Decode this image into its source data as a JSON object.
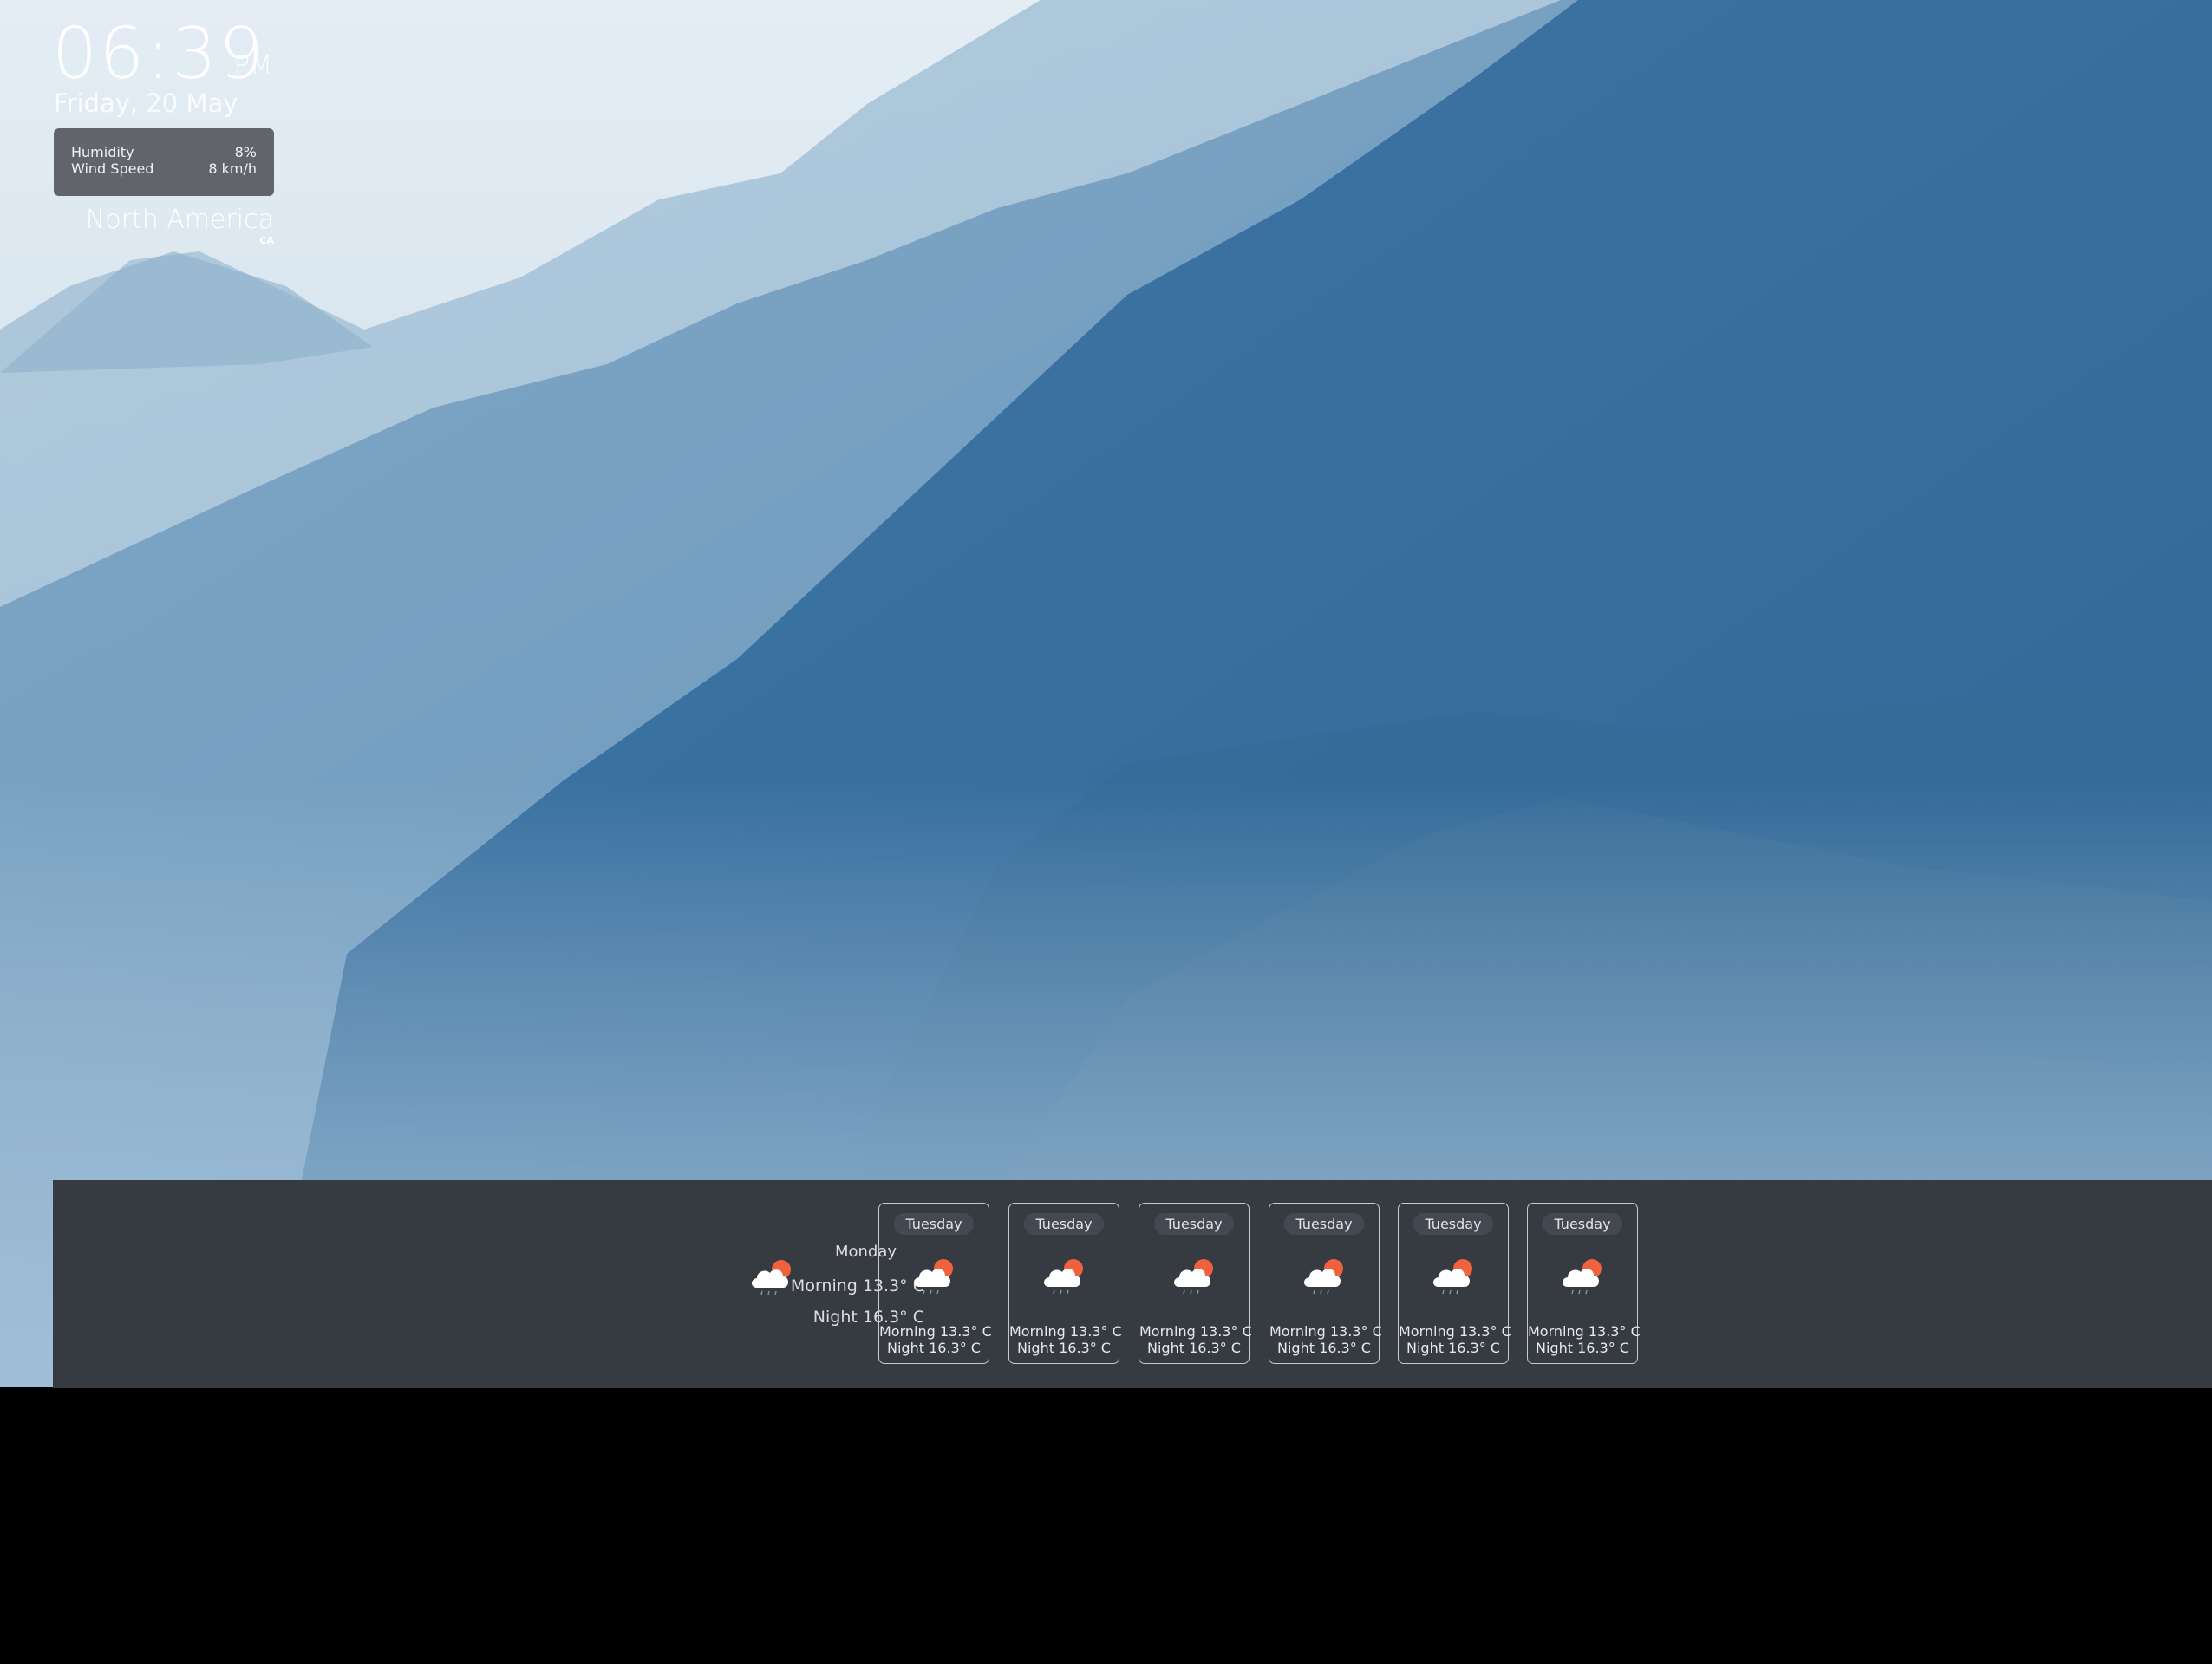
{
  "clock": {
    "time": "06:39",
    "ampm": "PM",
    "date": "Friday, 20 May"
  },
  "stats": {
    "humidity_label": "Humidity",
    "humidity_value": "8%",
    "wind_label": "Wind Speed",
    "wind_value": "8 km/h"
  },
  "location": {
    "name": "North America",
    "code": "CA"
  },
  "forecast": {
    "today": {
      "day": "Monday",
      "morning": "Morning 13.3° C",
      "night": "Night 16.3° C",
      "icon": "cloud-rain-sun-icon"
    },
    "days": [
      {
        "day": "Tuesday",
        "morning": "Morning 13.3° C",
        "night": "Night 16.3° C",
        "icon": "cloud-rain-sun-icon"
      },
      {
        "day": "Tuesday",
        "morning": "Morning 13.3° C",
        "night": "Night 16.3° C",
        "icon": "cloud-rain-sun-icon"
      },
      {
        "day": "Tuesday",
        "morning": "Morning 13.3° C",
        "night": "Night 16.3° C",
        "icon": "cloud-rain-sun-icon"
      },
      {
        "day": "Tuesday",
        "morning": "Morning 13.3° C",
        "night": "Night 16.3° C",
        "icon": "cloud-rain-sun-icon"
      },
      {
        "day": "Tuesday",
        "morning": "Morning 13.3° C",
        "night": "Night 16.3° C",
        "icon": "cloud-rain-sun-icon"
      },
      {
        "day": "Tuesday",
        "morning": "Morning 13.3° C",
        "night": "Night 16.3° C",
        "icon": "cloud-rain-sun-icon"
      }
    ]
  },
  "colors": {
    "panel": "#363a41",
    "sun": "#f0623e",
    "cloud": "#ffffff"
  }
}
